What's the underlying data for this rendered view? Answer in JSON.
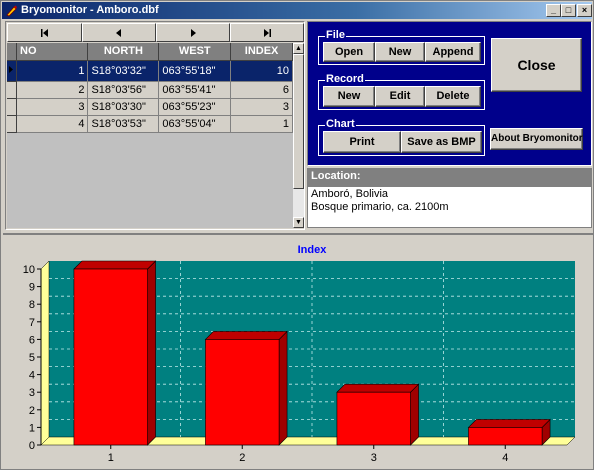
{
  "window": {
    "title": "Bryomonitor - Amboro.dbf",
    "app_icon": "pen-icon",
    "controls": [
      "minimize",
      "maximize",
      "close"
    ]
  },
  "navigator": {
    "buttons": [
      "first",
      "prior",
      "next",
      "last"
    ]
  },
  "grid": {
    "columns": [
      "NO",
      "NORTH",
      "WEST",
      "INDEX"
    ],
    "rows": [
      {
        "no": "1",
        "north": "S18°03'32\"",
        "west": "063°55'18\"",
        "index": "10",
        "selected": true
      },
      {
        "no": "2",
        "north": "S18°03'56\"",
        "west": "063°55'41\"",
        "index": "6",
        "selected": false
      },
      {
        "no": "3",
        "north": "S18°03'30\"",
        "west": "063°55'23\"",
        "index": "3",
        "selected": false
      },
      {
        "no": "4",
        "north": "S18°03'53\"",
        "west": "063°55'04\"",
        "index": "1",
        "selected": false
      }
    ]
  },
  "file_group": {
    "title": "File",
    "open": "Open",
    "new": "New",
    "append": "Append"
  },
  "record_group": {
    "title": "Record",
    "new": "New",
    "edit": "Edit",
    "delete": "Delete"
  },
  "chart_group": {
    "title": "Chart",
    "print": "Print",
    "save_bmp": "Save as BMP"
  },
  "close_label": "Close",
  "about_label": "About Bryomonitor",
  "location": {
    "label": "Location:",
    "line1": "Amboró, Bolivia",
    "line2": "Bosque primario, ca. 2100m"
  },
  "colors": {
    "plot_bg": "#008080",
    "bar": "#ff0000",
    "floor": "#ffff99",
    "title": "#0000ff",
    "panel": "#00008b"
  },
  "chart_data": {
    "type": "bar",
    "title": "Index",
    "categories": [
      "1",
      "2",
      "3",
      "4"
    ],
    "values": [
      10,
      6,
      3,
      1
    ],
    "ylim": [
      0,
      10
    ],
    "yticks": [
      0,
      1,
      2,
      3,
      4,
      5,
      6,
      7,
      8,
      9,
      10
    ],
    "xlabel": "",
    "ylabel": "",
    "grid": true,
    "style": "3d"
  }
}
